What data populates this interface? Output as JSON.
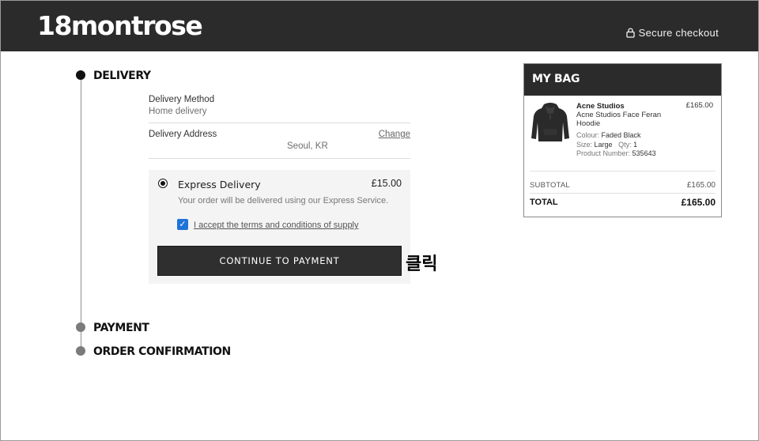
{
  "header": {
    "logo": "18montrose",
    "secure_checkout": "Secure checkout",
    "lock_icon": "lock-icon"
  },
  "steps": {
    "delivery": "DELIVERY",
    "payment": "PAYMENT",
    "order_confirmation": "ORDER CONFIRMATION"
  },
  "delivery": {
    "method_label": "Delivery Method",
    "method_value": "Home delivery",
    "address_label": "Delivery Address",
    "address_value": "Seoul, KR",
    "change_link": "Change"
  },
  "express": {
    "title": "Express Delivery",
    "price": "£15.00",
    "description": "Your order will be delivered using our Express Service.",
    "terms_label": "I accept the terms and conditions of supply",
    "checked": true,
    "continue_button": "CONTINUE TO PAYMENT"
  },
  "annotation": {
    "text": "클릭"
  },
  "bag": {
    "title": "MY BAG",
    "item": {
      "brand": "Acne Studios",
      "name": "Acne Studios Face Feran Hoodie",
      "price": "£165.00",
      "colour_label": "Colour:",
      "colour_value": "Faded Black",
      "size_label": "Size:",
      "size_value": "Large",
      "qty_label": "Qty:",
      "qty_value": "1",
      "product_number_label": "Product Number:",
      "product_number_value": "535643"
    },
    "subtotal_label": "SUBTOTAL",
    "subtotal_value": "£165.00",
    "total_label": "TOTAL",
    "total_value": "£165.00"
  },
  "colors": {
    "header_bg": "#2b2b2c",
    "button_bg": "#2f2f2f",
    "checkbox_blue": "#1e73d8"
  }
}
